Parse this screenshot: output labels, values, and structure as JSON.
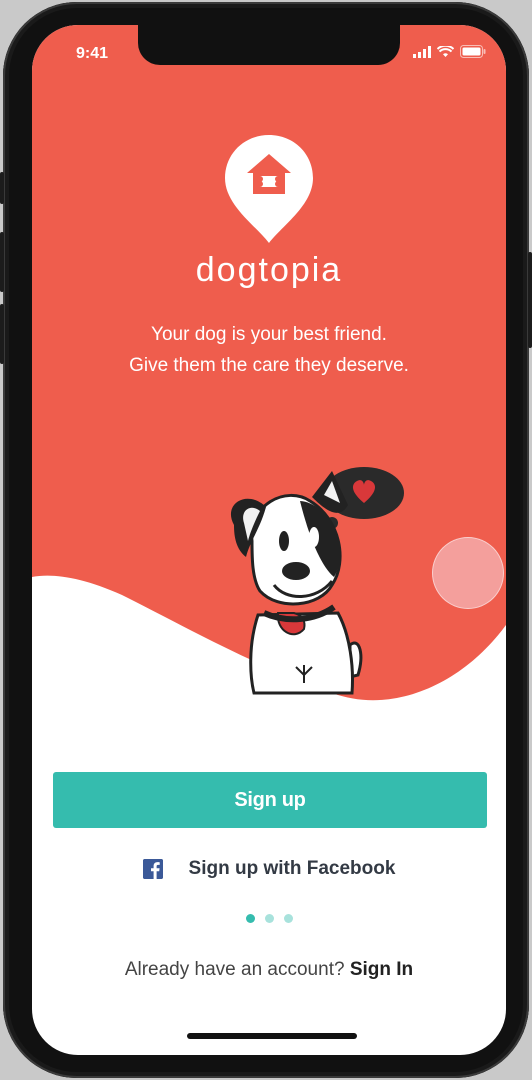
{
  "status_bar": {
    "time": "9:41"
  },
  "brand": {
    "name": "dogtopia"
  },
  "tagline": {
    "line1": "Your dog is your best friend.",
    "line2": "Give them the care they deserve."
  },
  "actions": {
    "signup_label": "Sign up",
    "facebook_label": "Sign up with Facebook"
  },
  "pager": {
    "count": 3,
    "active_index": 0
  },
  "footer": {
    "prompt": "Already have an account?",
    "signin_label": "Sign In"
  },
  "colors": {
    "hero": "#ef5d4d",
    "accent": "#35bcae",
    "facebook": "#3b5998"
  },
  "icons": [
    "signal-icon",
    "wifi-icon",
    "battery-icon",
    "doghouse-pin-logo",
    "facebook-icon",
    "heart-icon"
  ]
}
